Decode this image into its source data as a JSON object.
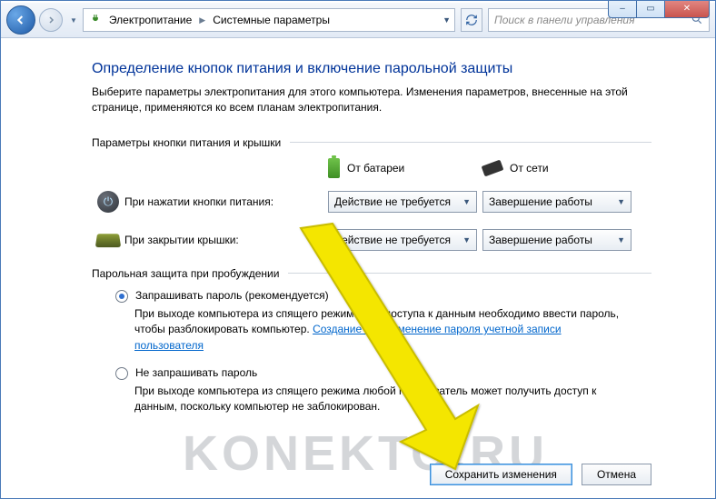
{
  "window_controls": {
    "min": "–",
    "max": "▭",
    "close": "✕"
  },
  "breadcrumb": {
    "root": "Электропитание",
    "current": "Системные параметры"
  },
  "search": {
    "placeholder": "Поиск в панели управления"
  },
  "title": "Определение кнопок питания и включение парольной защиты",
  "intro": "Выберите параметры электропитания для этого компьютера. Изменения параметров, внесенные на этой странице, применяются ко всем планам электропитания.",
  "group1": "Параметры кнопки питания и крышки",
  "columns": {
    "battery": "От батареи",
    "plugged": "От сети"
  },
  "settings": {
    "power_button": {
      "label": "При нажатии кнопки питания:",
      "battery": "Действие не требуется",
      "plugged": "Завершение работы"
    },
    "lid": {
      "label": "При закрытии крышки:",
      "battery": "Действие не требуется",
      "plugged": "Завершение работы"
    }
  },
  "group2": "Парольная защита при пробуждении",
  "password": {
    "opt1_label": "Запрашивать пароль (рекомендуется)",
    "opt1_desc_a": "При выходе компьютера из спящего режима для доступа к данным необходимо ввести пароль, чтобы разблокировать компьютер. ",
    "opt1_link": "Создание или изменение пароля учетной записи пользователя",
    "opt2_label": "Не запрашивать пароль",
    "opt2_desc": "При выходе компьютера из спящего режима любой пользователь может получить доступ к данным, поскольку компьютер не заблокирован."
  },
  "buttons": {
    "save": "Сохранить изменения",
    "cancel": "Отмена"
  },
  "watermark": "KONEKTO.RU"
}
